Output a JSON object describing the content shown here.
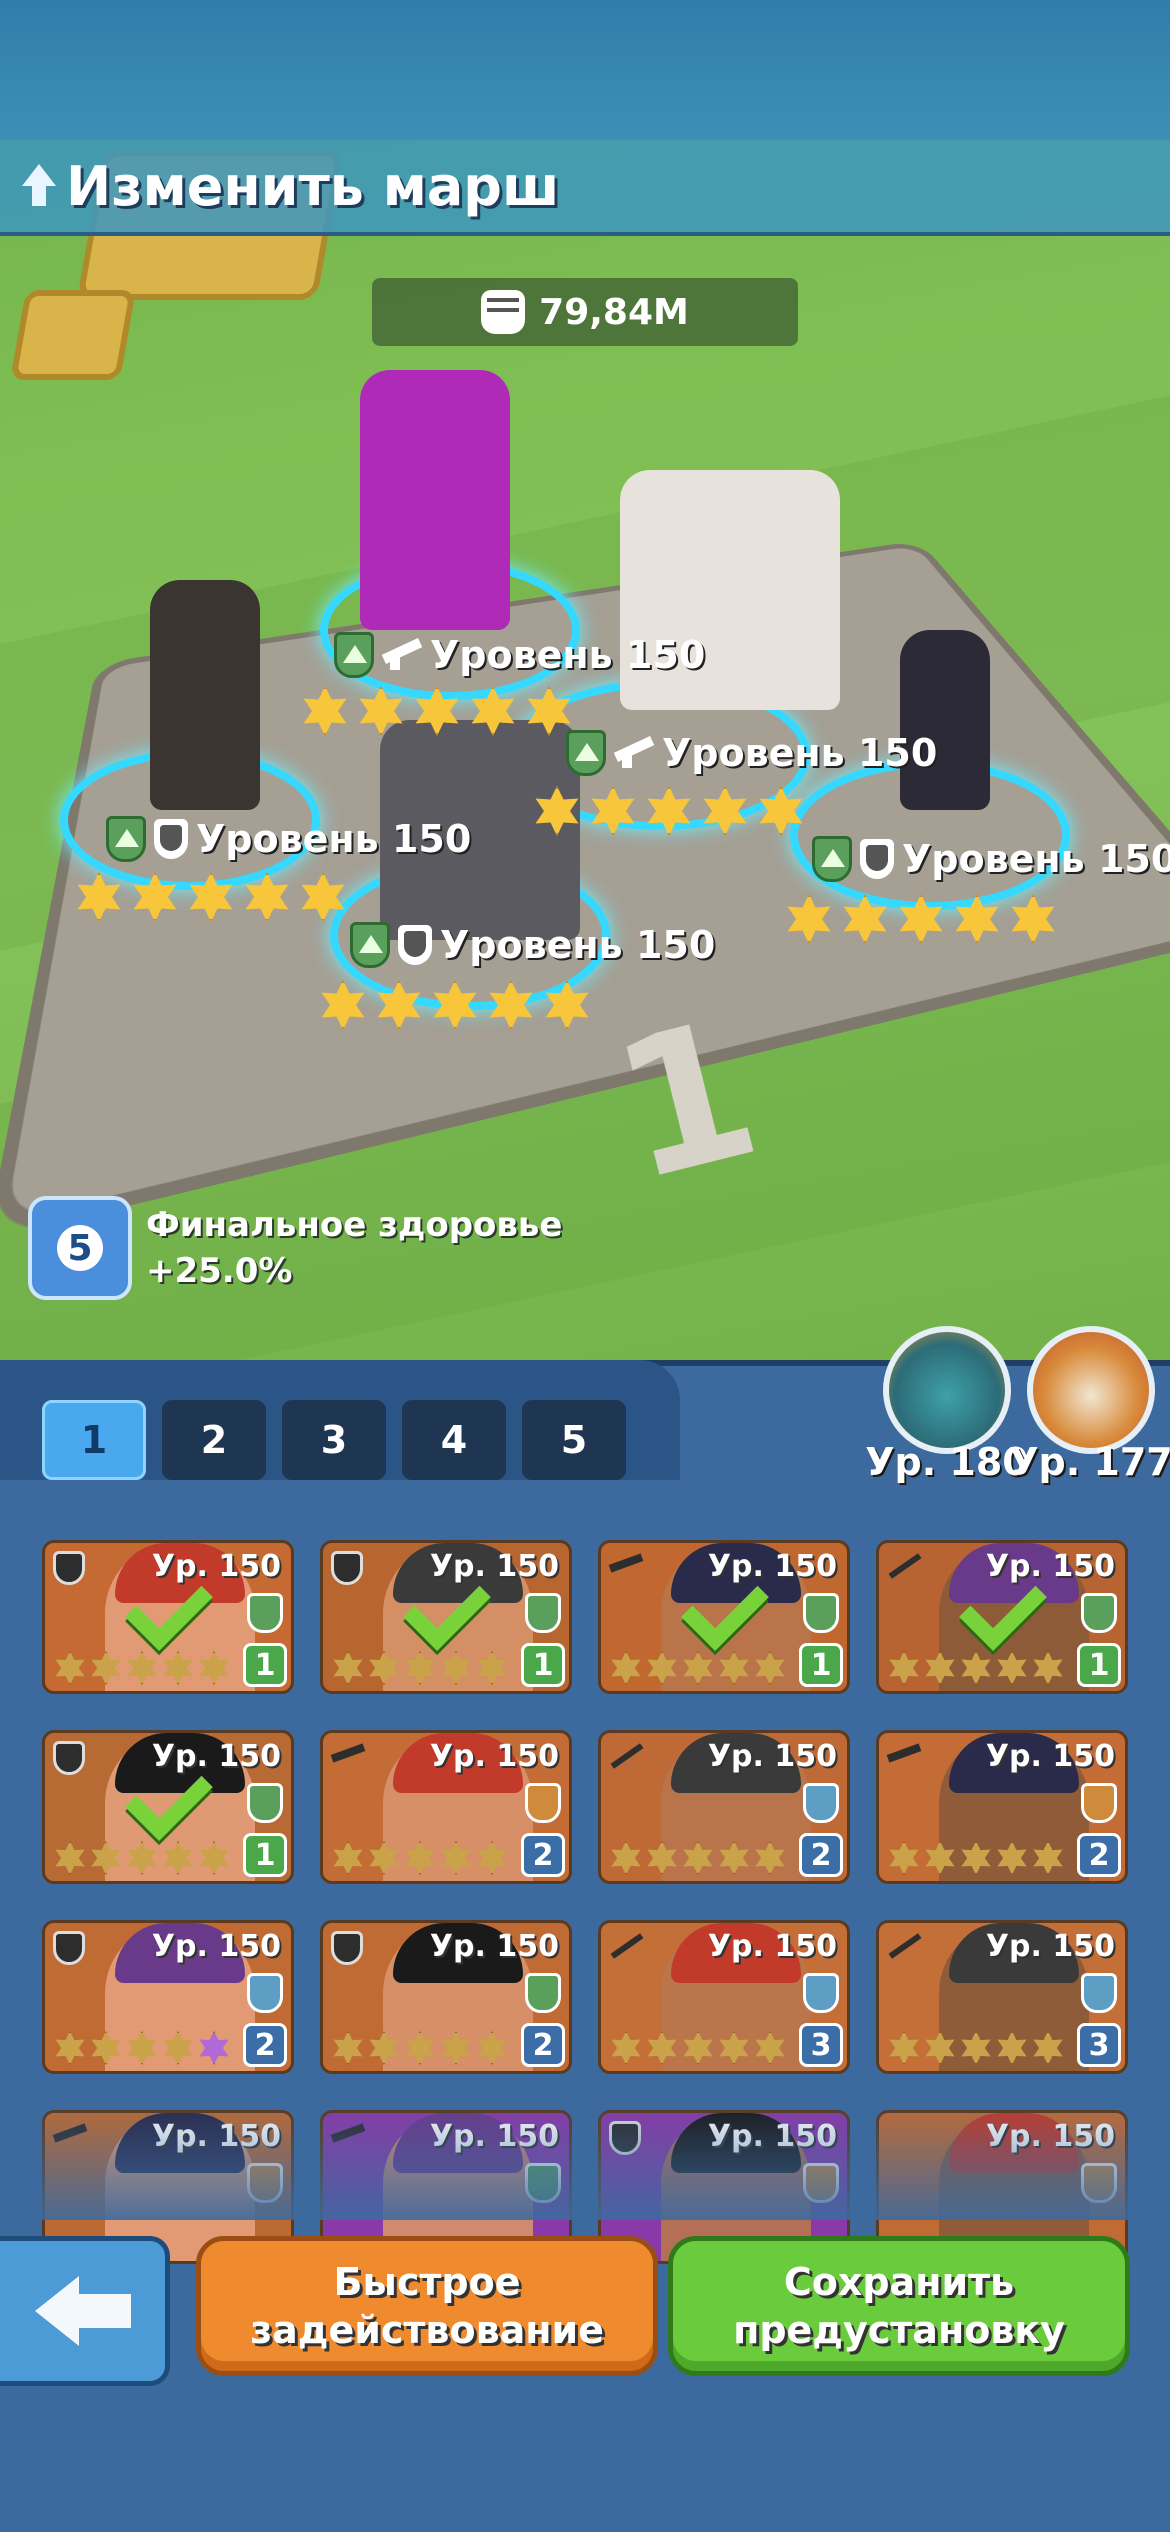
{
  "header": {
    "title": "Изменить марш"
  },
  "power": {
    "value": "79,84M"
  },
  "field_heroes": [
    {
      "level": "Уровень 150",
      "role": "rifle",
      "stars": 5
    },
    {
      "level": "Уровень 150",
      "role": "gun",
      "stars": 5
    },
    {
      "level": "Уровень 150",
      "role": "shield",
      "stars": 5
    },
    {
      "level": "Уровень 150",
      "role": "shield",
      "stars": 5
    },
    {
      "level": "Уровень 150",
      "role": "shield",
      "stars": 5
    }
  ],
  "bonus": {
    "count": "5",
    "label": "Финальное здоровье",
    "value": "+25.0%"
  },
  "tabs": [
    "1",
    "2",
    "3",
    "4",
    "5"
  ],
  "active_tab": "1",
  "pets": [
    {
      "name": "dragon",
      "level": "Ур. 180"
    },
    {
      "name": "eagle",
      "level": "Ур. 177"
    }
  ],
  "roster": [
    {
      "level": "Ур. 150",
      "role": "shield",
      "affinity": "green",
      "slot": "1",
      "selected": true,
      "bg": "#c46a32"
    },
    {
      "level": "Ур. 150",
      "role": "shield",
      "affinity": "green",
      "slot": "1",
      "selected": true,
      "bg": "#b86630"
    },
    {
      "level": "Ур. 150",
      "role": "gun",
      "affinity": "green",
      "slot": "1",
      "selected": true,
      "bg": "#c06830"
    },
    {
      "level": "Ур. 150",
      "role": "rifle",
      "affinity": "green",
      "slot": "1",
      "selected": true,
      "bg": "#b86432"
    },
    {
      "level": "Ур. 150",
      "role": "shield",
      "affinity": "green",
      "slot": "1",
      "selected": true,
      "bg": "#b86a34"
    },
    {
      "level": "Ур. 150",
      "role": "gun",
      "affinity": "orange",
      "slot": "2",
      "selected": false,
      "bg": "#c46c36"
    },
    {
      "level": "Ур. 150",
      "role": "rifle",
      "affinity": "blue",
      "slot": "2",
      "selected": false,
      "bg": "#bf6a36"
    },
    {
      "level": "Ур. 150",
      "role": "gun",
      "affinity": "orange",
      "slot": "2",
      "selected": false,
      "bg": "#c46c36"
    },
    {
      "level": "Ур. 150",
      "role": "shield",
      "affinity": "blue",
      "slot": "2",
      "selected": false,
      "bg": "#c06a34"
    },
    {
      "level": "Ур. 150",
      "role": "shield",
      "affinity": "green",
      "slot": "2",
      "selected": false,
      "bg": "#c06a34"
    },
    {
      "level": "Ур. 150",
      "role": "rifle",
      "affinity": "blue",
      "slot": "3",
      "selected": false,
      "bg": "#c46e38"
    },
    {
      "level": "Ур. 150",
      "role": "rifle",
      "affinity": "blue",
      "slot": "3",
      "selected": false,
      "bg": "#c46e38"
    },
    {
      "level": "Ур. 150",
      "role": "gun",
      "affinity": "orange",
      "slot": "",
      "selected": false,
      "bg": "#bc6a34"
    },
    {
      "level": "Ур. 150",
      "role": "gun",
      "affinity": "green",
      "slot": "",
      "selected": false,
      "bg": "#8a3aa8"
    },
    {
      "level": "Ур. 150",
      "role": "shield",
      "affinity": "orange",
      "slot": "",
      "selected": false,
      "bg": "#8a3aa8"
    },
    {
      "level": "Ур. 150",
      "role": "",
      "affinity": "orange",
      "slot": "",
      "selected": false,
      "bg": "#c06a34"
    }
  ],
  "actions": {
    "quick_deploy": "Быстрое задействование",
    "save_preset": "Сохранить предустановку"
  },
  "colors": {
    "panel": "#3d6a9e",
    "tab_active": "#4aa8ef",
    "check": "#7ad23a",
    "orange_btn": "#f08a2e",
    "green_btn": "#6acb3c"
  }
}
